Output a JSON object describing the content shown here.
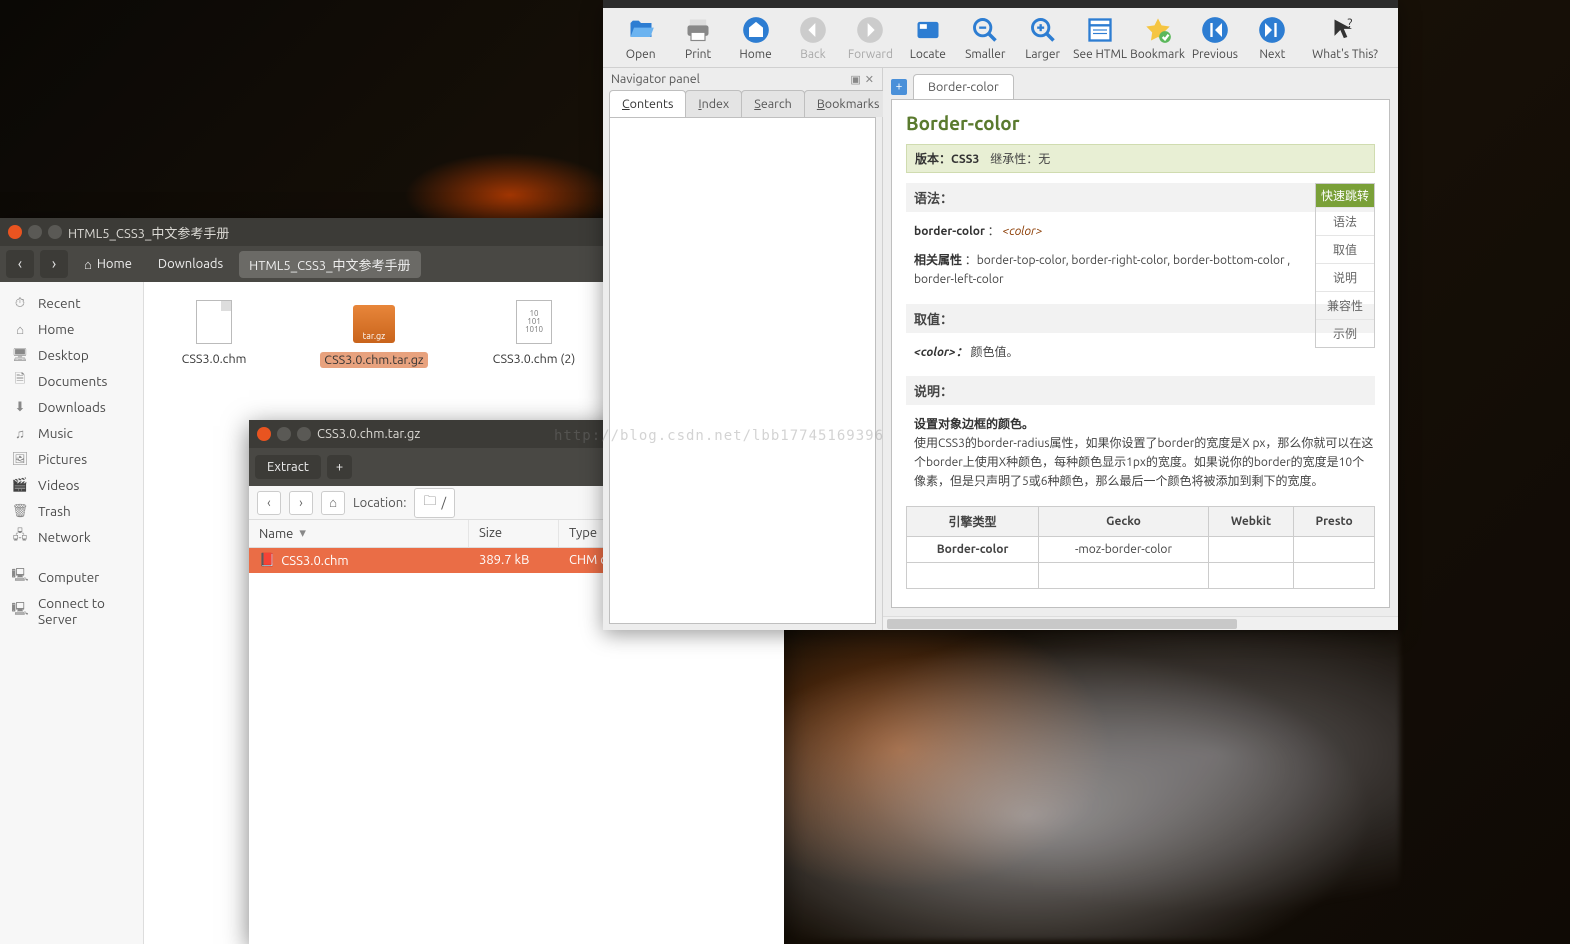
{
  "watermark": "http://blog.csdn.net/lbb17745169396",
  "file_manager": {
    "title": "HTML5_CSS3_中文参考手册",
    "nav_home": "Home",
    "crumbs": [
      "Downloads",
      "HTML5_CSS3_中文参考手册"
    ],
    "sidebar": {
      "items": [
        {
          "icon": "⏱",
          "label": "Recent"
        },
        {
          "icon": "⌂",
          "label": "Home"
        },
        {
          "icon": "🖥",
          "label": "Desktop"
        },
        {
          "icon": "🗎",
          "label": "Documents"
        },
        {
          "icon": "⬇",
          "label": "Downloads"
        },
        {
          "icon": "♫",
          "label": "Music"
        },
        {
          "icon": "🖼",
          "label": "Pictures"
        },
        {
          "icon": "🎬",
          "label": "Videos"
        },
        {
          "icon": "🗑",
          "label": "Trash"
        },
        {
          "icon": "🖧",
          "label": "Network"
        }
      ],
      "items2": [
        {
          "icon": "🖳",
          "label": "Computer"
        },
        {
          "icon": "🖳",
          "label": "Connect to Server"
        }
      ]
    },
    "files": [
      {
        "name": "CSS3.0.chm",
        "type": "doc"
      },
      {
        "name": "CSS3.0.chm.tar.gz",
        "type": "tar",
        "selected": true
      },
      {
        "name": "CSS3.0.chm (2)",
        "type": "bin"
      }
    ]
  },
  "archive": {
    "title": "CSS3.0.chm.tar.gz",
    "extract": "Extract",
    "plus": "+",
    "location_label": "Location:",
    "location_path": "/",
    "columns": {
      "name": "Name",
      "size": "Size",
      "type": "Type"
    },
    "row": {
      "name": "CSS3.0.chm",
      "size": "389.7 kB",
      "type": "CHM d"
    }
  },
  "chm": {
    "toolbar": [
      {
        "label": "Open",
        "color": "#2d7dd2"
      },
      {
        "label": "Print",
        "color": "#888"
      },
      {
        "label": "Home",
        "color": "#2d7dd2"
      },
      {
        "label": "Back",
        "color": "#aaa",
        "disabled": true
      },
      {
        "label": "Forward",
        "color": "#aaa",
        "disabled": true
      },
      {
        "label": "Locate",
        "color": "#2d7dd2"
      },
      {
        "label": "Smaller",
        "color": "#2d7dd2"
      },
      {
        "label": "Larger",
        "color": "#2d7dd2"
      },
      {
        "label": "See HTML",
        "color": "#2d7dd2"
      },
      {
        "label": "Bookmark",
        "color": "#f5c542"
      },
      {
        "label": "Previous",
        "color": "#2d7dd2"
      },
      {
        "label": "Next",
        "color": "#2d7dd2"
      },
      {
        "label": "What's This?",
        "wide": true
      }
    ],
    "nav_title": "Navigator panel",
    "nav_tabs": [
      "Contents",
      "Index",
      "Search",
      "Bookmarks"
    ],
    "doc_tab": "Border-color",
    "doc": {
      "h1": "Border-color",
      "version_label": "版本：",
      "version": "CSS3",
      "inherit_label": "继承性：",
      "inherit": "无",
      "quick_head": "快速跳转",
      "quick": [
        "语法",
        "取值",
        "说明",
        "兼容性",
        "示例"
      ],
      "syntax_head": "语法：",
      "syntax_prop": "border-color",
      "syntax_val": "<color>",
      "related_label": "相关属性",
      "related": "：border-top-color, border-right-color, border-bottom-color , border-left-color",
      "values_head": "取值：",
      "value_key": "<color>：",
      "value_txt": "颜色值。",
      "desc_head": "说明：",
      "desc_bold": "设置对象边框的颜色。",
      "desc_body": "使用CSS3的border-radius属性，如果你设置了border的宽度是X px，那么你就可以在这个border上使用X种颜色，每种颜色显示1px的宽度。如果说你的border的宽度是10个像素，但是只声明了5或6种颜色，那么最后一个颜色将被添加到剩下的宽度。",
      "table": {
        "head": [
          "引擎类型",
          "Gecko",
          "Webkit",
          "Presto"
        ],
        "row": [
          "Border-color",
          "-moz-border-color",
          "",
          ""
        ]
      }
    }
  }
}
